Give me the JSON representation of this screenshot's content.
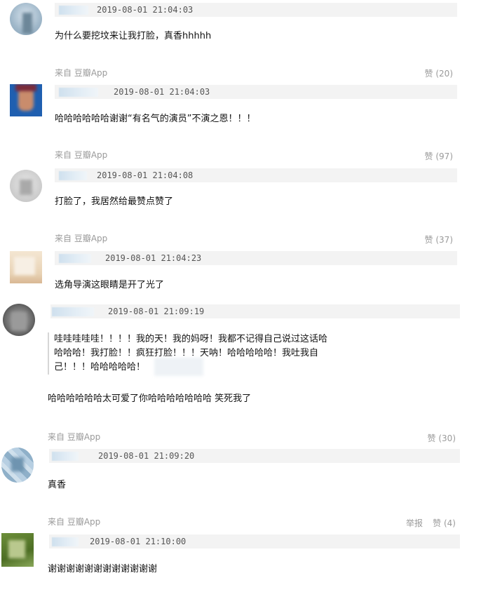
{
  "comments": [
    {
      "timestamp": "2019-08-01 21:04:03",
      "text": "为什么要挖坟来让我打脸，真香hhhhh",
      "source": "来自  豆瓣App",
      "votes": "赞 (20)"
    },
    {
      "timestamp": "2019-08-01 21:04:03",
      "text": "哈哈哈哈哈哈谢谢“有名气的演员”不演之恩！！！",
      "source": "来自  豆瓣App",
      "votes": "赞 (97)"
    },
    {
      "timestamp": "2019-08-01 21:04:08",
      "text": "打脸了，我居然给最赞点赞了",
      "source": "来自  豆瓣App",
      "votes": "赞 (37)"
    },
    {
      "timestamp": "2019-08-01 21:04:23",
      "text": "选角导演这眼睛是开了光了"
    },
    {
      "timestamp": "2019-08-01 21:09:19",
      "quote_lines": [
        "哇哇哇哇哇！！！！我的天！我的妈呀！我都不记得自己说过这话哈",
        "哈哈哈！我打脸！！疯狂打脸！！！天呐！哈哈哈哈哈！我吐我自",
        "己！！！哈哈哈哈哈！"
      ],
      "text": "哈哈哈哈哈哈太可爱了你哈哈哈哈哈哈哈  笑死我了",
      "source": "来自  豆瓣App",
      "votes": "赞 (30)"
    },
    {
      "timestamp": "2019-08-01 21:09:20",
      "text": "真香",
      "source": "来自  豆瓣App",
      "report": "举报",
      "votes": "赞 (4)"
    },
    {
      "timestamp": "2019-08-01 21:10:00",
      "text": "谢谢谢谢谢谢谢谢谢谢谢谢"
    }
  ]
}
